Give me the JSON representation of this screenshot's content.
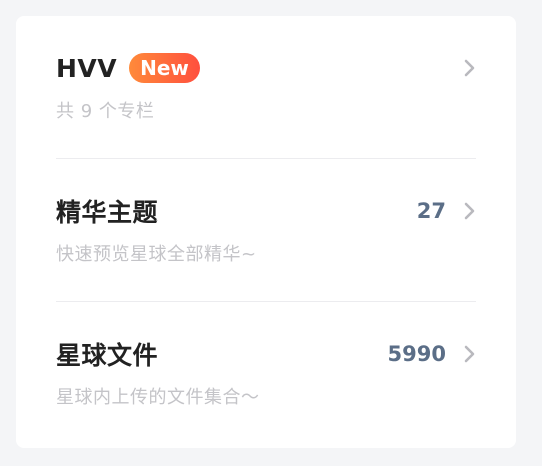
{
  "list": {
    "items": [
      {
        "title": "HVV",
        "badge": "New",
        "count": "",
        "subtitle": "共 9 个专栏"
      },
      {
        "title": "精华主题",
        "badge": "",
        "count": "27",
        "subtitle": "快速预览星球全部精华~"
      },
      {
        "title": "星球文件",
        "badge": "",
        "count": "5990",
        "subtitle": "星球内上传的文件集合～"
      }
    ]
  },
  "icons": {
    "chevron": "chevron-right-icon"
  },
  "colors": {
    "badge_gradient_start": "#ff8a3a",
    "badge_gradient_end": "#ff4f3e",
    "count_text": "#5b6e87",
    "subtitle_text": "#c4c4c8",
    "title_text": "#222222"
  }
}
